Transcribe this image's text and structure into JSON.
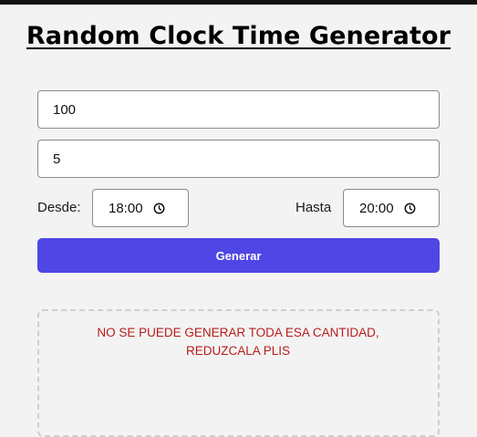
{
  "title": "Random Clock Time Generator",
  "inputs": {
    "quantity_value": "100",
    "second_value": "5"
  },
  "time_range": {
    "from_label": "Desde:",
    "from_value": "18:00",
    "to_label": "Hasta",
    "to_value": "20:00"
  },
  "generate_button": "Generar",
  "result": {
    "error_message": "NO SE PUEDE GENERAR TODA ESA CANTIDAD, REDUZCALA PLIS"
  },
  "colors": {
    "button_bg": "#4f46e5",
    "error_text": "#b91c1c",
    "page_bg": "#f3f3f3"
  },
  "icons": [
    "clock-icon"
  ]
}
